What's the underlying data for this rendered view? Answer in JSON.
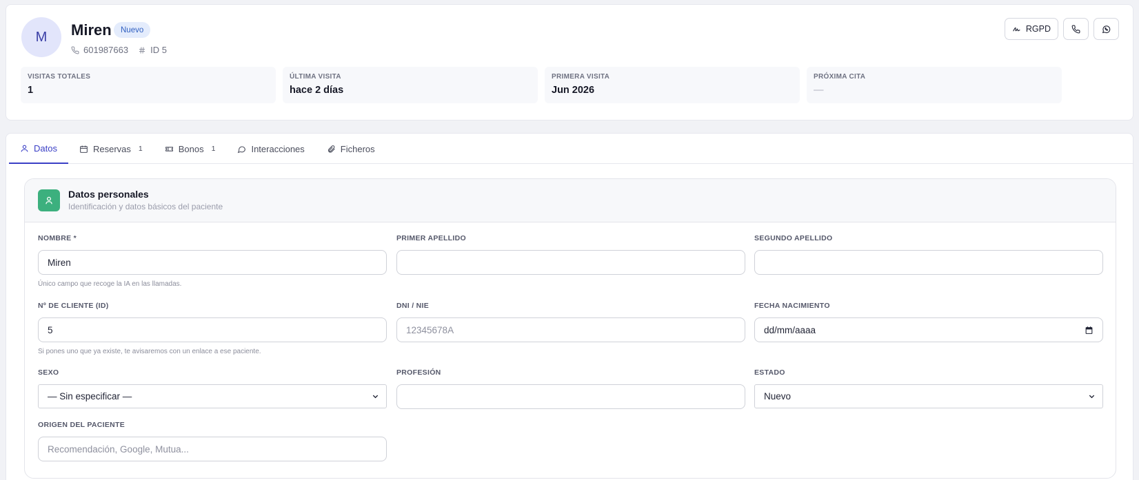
{
  "patient": {
    "initial": "M",
    "name": "Miren",
    "badge": "Nuevo",
    "phone": "601987663",
    "id_label": "ID 5"
  },
  "header_actions": {
    "rgpd_label": "RGPD"
  },
  "stats": [
    {
      "label": "VISITAS TOTALES",
      "value": "1"
    },
    {
      "label": "ÚLTIMA VISITA",
      "value": "hace 2 días"
    },
    {
      "label": "PRIMERA VISITA",
      "value": "Jun 2026"
    },
    {
      "label": "PRÓXIMA CITA",
      "value": "—"
    }
  ],
  "tabs": [
    {
      "label": "Datos",
      "icon": "user-icon",
      "active": true
    },
    {
      "label": "Reservas",
      "icon": "calendar-icon",
      "count": "1"
    },
    {
      "label": "Bonos",
      "icon": "ticket-icon",
      "count": "1"
    },
    {
      "label": "Interacciones",
      "icon": "chat-icon"
    },
    {
      "label": "Ficheros",
      "icon": "paperclip-icon"
    }
  ],
  "section": {
    "title": "Datos personales",
    "subtitle": "Identificación y datos básicos del paciente"
  },
  "fields": {
    "nombre": {
      "label": "NOMBRE *",
      "value": "Miren",
      "hint": "Único campo que recoge la IA en las llamadas."
    },
    "primer_apellido": {
      "label": "PRIMER APELLIDO",
      "value": ""
    },
    "segundo_apellido": {
      "label": "SEGUNDO APELLIDO",
      "value": ""
    },
    "numero_cliente": {
      "label": "Nº DE CLIENTE (ID)",
      "value": "5",
      "hint": "Si pones uno que ya existe, te avisaremos con un enlace a ese paciente."
    },
    "dni": {
      "label": "DNI / NIE",
      "value": "",
      "placeholder": "12345678A"
    },
    "fecha_nacimiento": {
      "label": "FECHA NACIMIENTO",
      "placeholder": "dd/mm/aaaa"
    },
    "sexo": {
      "label": "SEXO",
      "selected": "— Sin especificar —"
    },
    "profesion": {
      "label": "PROFESIÓN",
      "value": ""
    },
    "estado": {
      "label": "ESTADO",
      "selected": "Nuevo"
    },
    "origen": {
      "label": "ORIGEN DEL PACIENTE",
      "value": "",
      "placeholder": "Recomendación, Google, Mutua..."
    }
  },
  "colors": {
    "accent": "#3a3fc6",
    "section_icon_bg": "#3cb07e",
    "badge_bg": "#e4ecfc"
  }
}
